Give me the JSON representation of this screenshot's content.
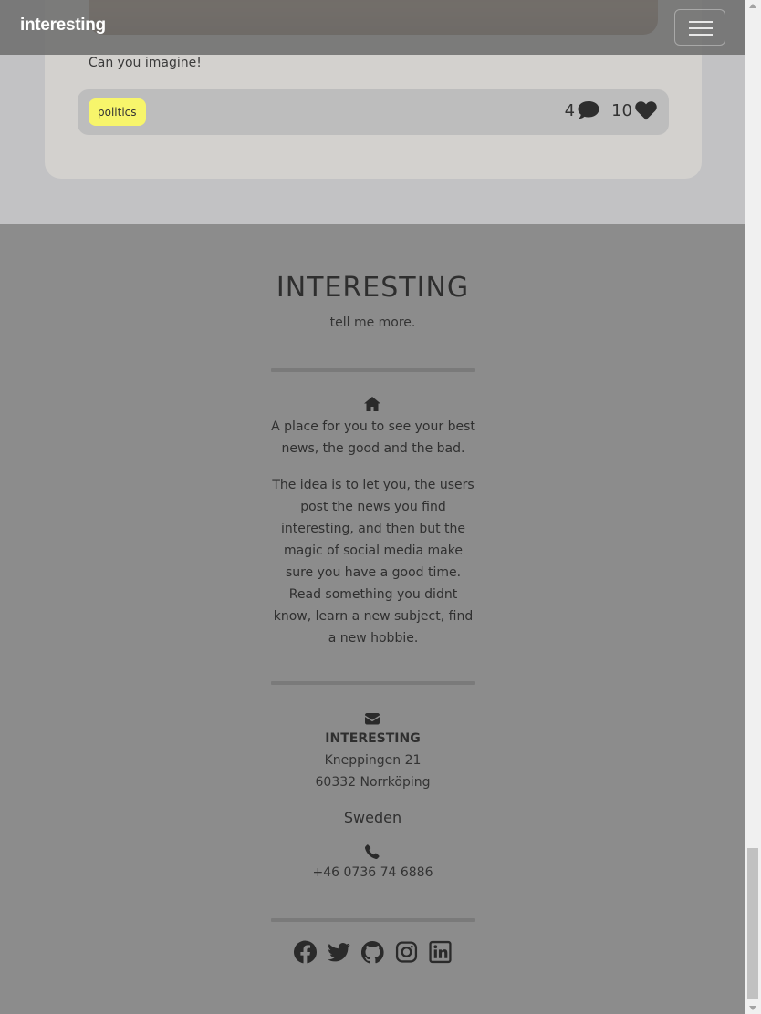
{
  "navbar": {
    "brand": "interesting",
    "menu_icon": "hamburger-menu-icon"
  },
  "post": {
    "caption": "Can you imagine!",
    "tag": "politics",
    "comment_count": "4",
    "comment_icon": "comment-icon",
    "like_count": "10",
    "like_icon": "heart-icon"
  },
  "footer": {
    "title": "INTERESTING",
    "tagline": "tell me more.",
    "about_icon": "home-icon",
    "about_paragraph_1": "A place for you to see your best news, the good and the bad.",
    "about_paragraph_2": "The idea is to let you, the users post the news you find interesting, and then but the magic of social media make sure you have a good time. Read something you didnt know, learn a new subject, find a new hobbie.",
    "contact_icon": "envelope-icon",
    "company": "INTERESTING",
    "street": "Kneppingen 21",
    "city": "60332 Norrköping",
    "country": "Sweden",
    "phone_icon": "phone-icon",
    "phone": "+46 0736 74 6886",
    "socials": [
      "facebook-icon",
      "twitter-icon",
      "github-icon",
      "instagram-icon",
      "linkedin-icon"
    ]
  },
  "colors": {
    "footer_bg": "#8c8c8c",
    "tag_bg": "#f7f56b",
    "navbar_bg": "#6e6e6e"
  }
}
